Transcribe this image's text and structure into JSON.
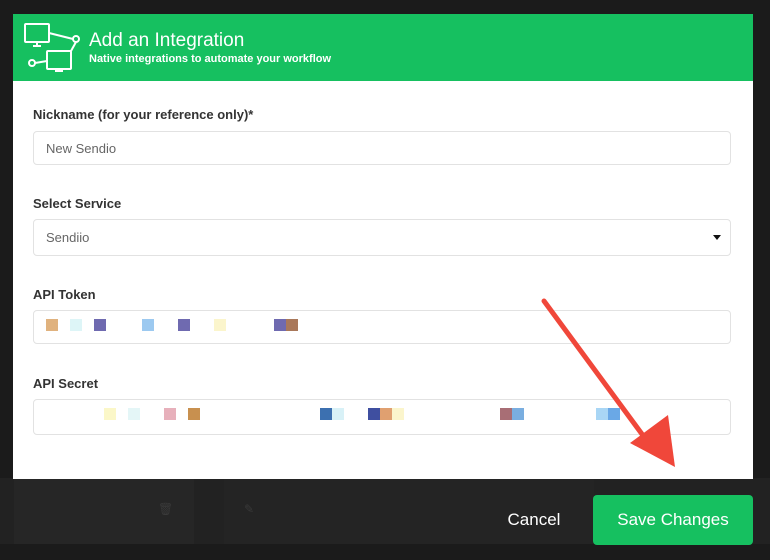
{
  "colors": {
    "accent": "#16c060",
    "arrow": "#f0473a",
    "overlay": "#1b1b1b"
  },
  "modal": {
    "title": "Add an Integration",
    "subtitle": "Native integrations to automate your workflow",
    "logo_icon": "network-computers-icon"
  },
  "form": {
    "nickname": {
      "label": "Nickname (for your reference only)*",
      "value": "New Sendio"
    },
    "service": {
      "label": "Select Service",
      "value": "Sendiio"
    },
    "api_token": {
      "label": "API Token",
      "redacted_colors": [
        "#e0b27e",
        "#ddf5f7",
        "#6f6ab0",
        "#9cc9f0",
        "#6f6ab0",
        "#fbf5cc",
        "#6f6ab0",
        "#a9785a"
      ]
    },
    "api_secret": {
      "label": "API Secret",
      "redacted_colors": [
        "#fbf7c8",
        "#e4f6f7",
        "#e7b0bb",
        "#c8904f",
        "#3c70b0",
        "#d8f1f7",
        "#3f4fa0",
        "#e0a070",
        "#fbf5cc",
        "#a86e75",
        "#7aaee0",
        "#a9d6f5",
        "#6aa8e6"
      ]
    }
  },
  "footer": {
    "cancel_label": "Cancel",
    "save_label": "Save Changes"
  }
}
